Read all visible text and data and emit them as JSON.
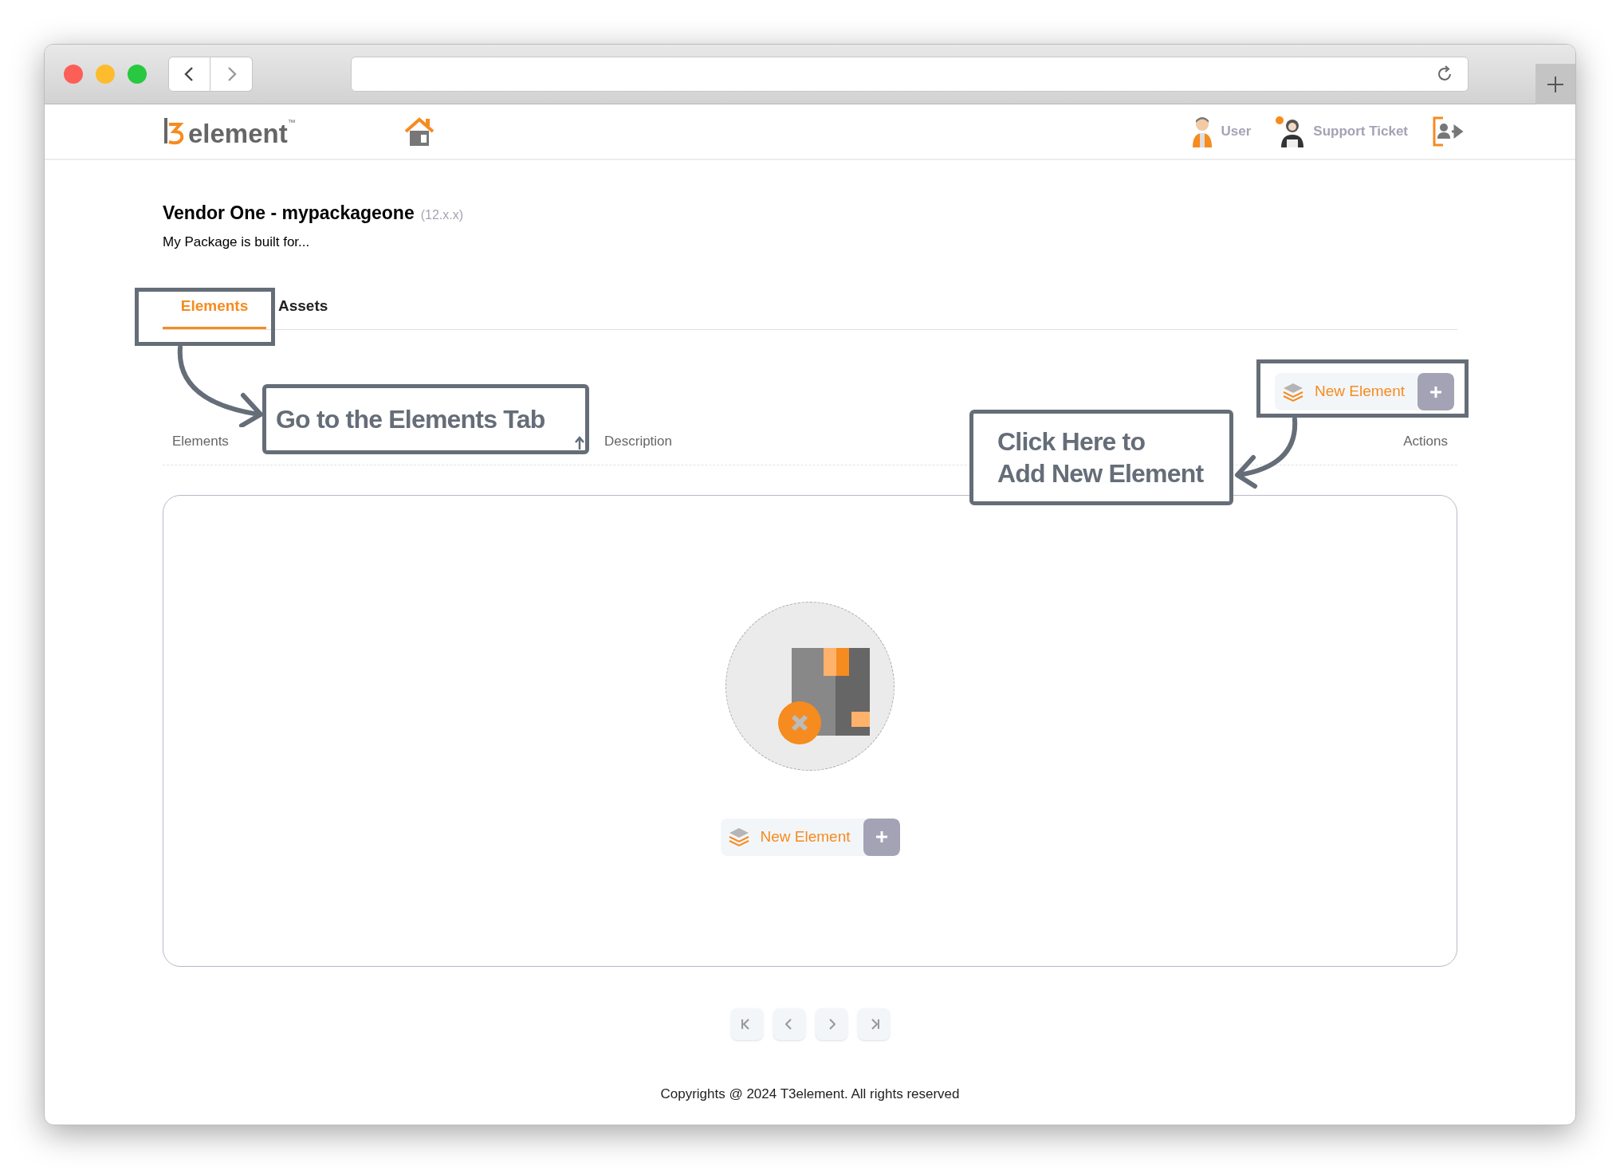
{
  "nav": {
    "logo_text": "element",
    "logo_mark": "™",
    "links": [
      {
        "label": "User",
        "kind": "user"
      },
      {
        "label": "Support Ticket",
        "kind": "support"
      }
    ]
  },
  "package": {
    "title": "Vendor One - mypackageone",
    "version": "(12.x.x)",
    "description": "My Package is built for..."
  },
  "tabs": [
    {
      "label": "Elements",
      "selected": true
    },
    {
      "label": "Assets",
      "selected": false
    }
  ],
  "table": {
    "columns": [
      "Elements",
      "Description",
      "Actions"
    ]
  },
  "header_button": {
    "label": "New Element"
  },
  "empty_state": {
    "button": {
      "label": "New Element"
    }
  },
  "footer": "Copyrights @ 2024 T3element. All rights reserved",
  "annotations": [
    {
      "lines": [
        "Go to the Elements Tab"
      ]
    },
    {
      "lines": [
        "Click Here to",
        "Add New Element"
      ]
    }
  ]
}
